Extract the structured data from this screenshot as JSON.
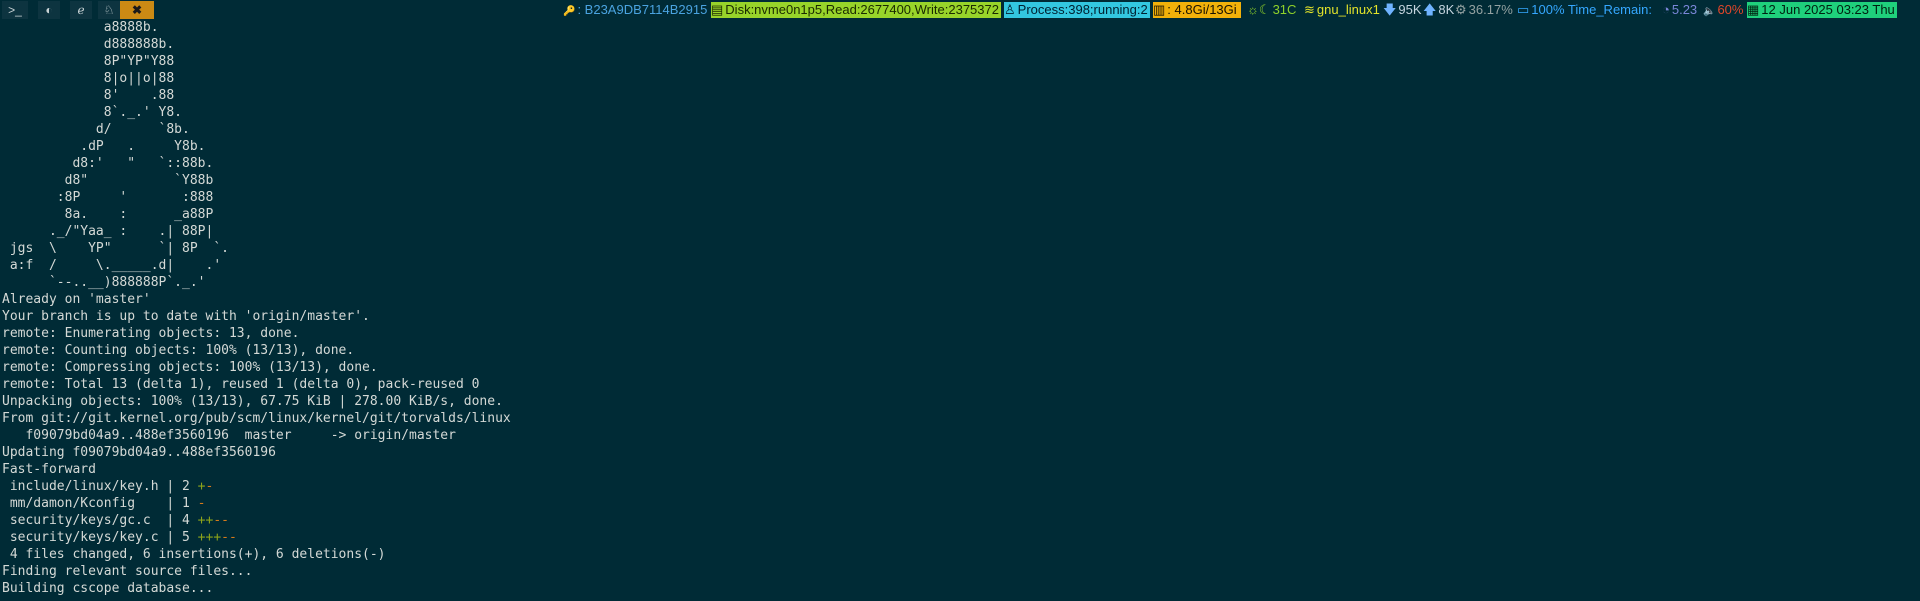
{
  "workspaces": [
    {
      "glyph": ">_",
      "icon": "terminal-icon",
      "active": false
    },
    {
      "glyph": "◐",
      "icon": "browser-icon",
      "active": false
    },
    {
      "glyph": "ℯ",
      "icon": "editor-icon",
      "active": false
    },
    {
      "glyph": "♘",
      "icon": "linux-icon",
      "active": false
    },
    {
      "glyph": "✖",
      "icon": "tools-icon",
      "active": true
    }
  ],
  "statusbar": {
    "key_glyph": "🔑",
    "key_id": ": B23A9DB7114B2915",
    "disk_glyph": "▤",
    "disk": "Disk:nvme0n1p5,Read:2677400,Write:2375372",
    "process_glyph": "♙",
    "process": "Process:398;running:2",
    "mem_glyph": "▥",
    "mem": ": 4.8Gi/13Gi",
    "temp_glyph": "☼☾",
    "temp": "31C",
    "wifi_glyph": "≋",
    "wifi": "gnu_linux1",
    "down_glyph": "🡇",
    "down": "95K",
    "up_glyph": "🡅",
    "up": "8K",
    "cpu_glyph": "⚙",
    "cpu": "36.17%",
    "battery_glyph": "▭",
    "battery": "100% Time_Remain:",
    "load_glyph": "◔",
    "load": "5.23",
    "volume_glyph": "🔈",
    "volume": "60%",
    "date_glyph": "▦",
    "datetime": "12 Jun 2025 03:23 Thu"
  },
  "colors": {
    "terminal_bg": "#002b36",
    "terminal_fg": "#d4d9d6",
    "accent_orange": "#cb8a14",
    "disk_bg": "#98d42a",
    "process_bg": "#33c7e0",
    "mem_bg": "#f2b10a",
    "datetime_bg": "#1fd07c",
    "diff_plus": "#8da31a",
    "diff_minus": "#d57a1b"
  },
  "terminal": {
    "lines": [
      "             a8888b.",
      "             d888888b.",
      "             8P\"YP\"Y88",
      "             8|o||o|88",
      "             8'    .88",
      "             8`._.' Y8.",
      "            d/      `8b.",
      "          .dP   .     Y8b.",
      "         d8:'   \"   `::88b.",
      "        d8\"           `Y88b",
      "       :8P     '       :888",
      "        8a.    :      _a88P",
      "      ._/\"Yaa_ :    .| 88P|",
      " jgs  \\    YP\"      `| 8P  `.",
      " a:f  /     \\._____.d|    .'",
      "      `--..__)888888P`._.'",
      "Already on 'master'",
      "Your branch is up to date with 'origin/master'.",
      "remote: Enumerating objects: 13, done.",
      "remote: Counting objects: 100% (13/13), done.",
      "remote: Compressing objects: 100% (13/13), done.",
      "remote: Total 13 (delta 1), reused 1 (delta 0), pack-reused 0",
      "Unpacking objects: 100% (13/13), 67.75 KiB | 278.00 KiB/s, done.",
      "From git://git.kernel.org/pub/scm/linux/kernel/git/torvalds/linux",
      "   f09079bd04a9..488ef3560196  master     -> origin/master",
      "Updating f09079bd04a9..488ef3560196",
      "Fast-forward"
    ],
    "diffstat": [
      {
        "file": " include/linux/key.h | 2 ",
        "plus": "+",
        "minus": "-"
      },
      {
        "file": " mm/damon/Kconfig    | 1 ",
        "plus": "",
        "minus": "-"
      },
      {
        "file": " security/keys/gc.c  | 4 ",
        "plus": "++",
        "minus": "--"
      },
      {
        "file": " security/keys/key.c | 5 ",
        "plus": "+++",
        "minus": "--"
      }
    ],
    "tail_lines": [
      " 4 files changed, 6 insertions(+), 6 deletions(-)",
      "Finding relevant source files...",
      "Building cscope database..."
    ]
  }
}
